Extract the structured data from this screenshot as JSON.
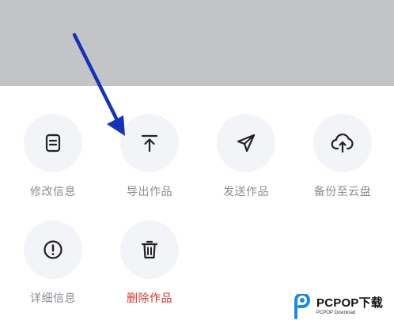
{
  "actions": [
    {
      "label": "修改信息",
      "icon": "edit-document-icon"
    },
    {
      "label": "导出作品",
      "icon": "export-upload-icon"
    },
    {
      "label": "发送作品",
      "icon": "send-paper-plane-icon"
    },
    {
      "label": "备份至云盘",
      "icon": "cloud-upload-icon"
    },
    {
      "label": "详细信息",
      "icon": "info-exclamation-icon"
    },
    {
      "label": "删除作品",
      "icon": "trash-icon"
    }
  ],
  "colors": {
    "overlay": "#c3c4c6",
    "icon_circle": "#f3f4f7",
    "label_default": "#8a8d93",
    "label_danger": "#d0342c",
    "annotation_arrow": "#1632b8",
    "watermark_accent": "#1e88e5"
  },
  "watermark": {
    "logo": "PCPOP下载",
    "tagline": "PCPOP Download"
  }
}
